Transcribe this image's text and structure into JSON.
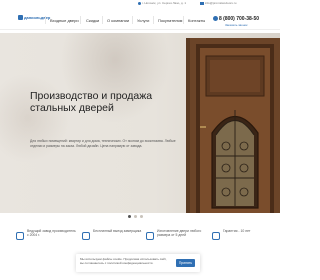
{
  "topbar": {
    "city": "г. Ногинск, ул. Сергея Лазо, д. 1",
    "email": "info@promstal-doors.ru"
  },
  "logo": {
    "text": "даниэльдвер"
  },
  "nav": {
    "items": [
      "Входные двери",
      "Скидки",
      "О компании",
      "Услуги",
      "Покупателям",
      "Контакты"
    ]
  },
  "contact": {
    "phone": "8 (800) 700-38-50",
    "callback": "Заказать звонок"
  },
  "hero": {
    "title": "Производство и продажа стальных дверей",
    "description": "Для любых помещений: квартир и для дома, технических. От эконом до эксклюзива. Любые отделки и размеры на заказ. Любой дизайн. Цена напрямую от завода."
  },
  "slider": {
    "count": 3,
    "active": 1
  },
  "features": [
    "Ведущий завод производитель с 2004 г.",
    "Бесплатный выезд замерщика",
    "Изготовление двери любого размера от 5 дней",
    "Гарантия - 10 лет"
  ],
  "cookie": {
    "text": "Мы используем файлы cookie. Продолжая использовать сайт, вы соглашаетесь с политикой конфиденциальности.",
    "button": "Принять"
  }
}
